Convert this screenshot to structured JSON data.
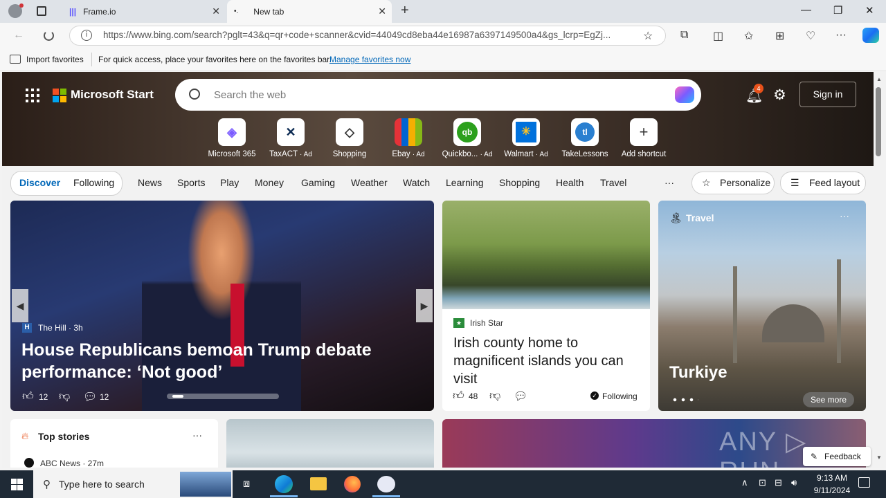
{
  "tabs": [
    {
      "title": "Frame.io"
    },
    {
      "title": "New tab"
    }
  ],
  "address_bar": {
    "url": "https://www.bing.com/search?pglt=43&q=qr+code+scanner&cvid=44049cd8eba44e16987a6397149500a4&gs_lcrp=EgZj..."
  },
  "favorites_bar": {
    "import_label": "Import favorites",
    "hint": "For quick access, place your favorites here on the favorites bar.",
    "manage_link": "Manage favorites now"
  },
  "header": {
    "brand": "Microsoft Start",
    "search_placeholder": "Search the web",
    "notification_count": "4",
    "sign_in": "Sign in"
  },
  "shortcuts": [
    {
      "label": "Microsoft 365",
      "ad": ""
    },
    {
      "label": "TaxACT",
      "ad": "· Ad"
    },
    {
      "label": "Shopping",
      "ad": ""
    },
    {
      "label": "Ebay",
      "ad": "· Ad"
    },
    {
      "label": "Quickbo...",
      "ad": "· Ad"
    },
    {
      "label": "Walmart",
      "ad": "· Ad"
    },
    {
      "label": "TakeLessons",
      "ad": ""
    },
    {
      "label": "Add shortcut",
      "ad": ""
    }
  ],
  "categories": {
    "discover": "Discover",
    "following": "Following",
    "items": [
      "News",
      "Sports",
      "Play",
      "Money",
      "Gaming",
      "Weather",
      "Watch",
      "Learning",
      "Shopping",
      "Health",
      "Travel"
    ],
    "more": "···",
    "personalize": "Personalize",
    "feed_layout": "Feed layout"
  },
  "main_story": {
    "source": "The Hill · 3h",
    "headline": "House Republicans bemoan Trump debate performance: ‘Not good’",
    "likes": "12",
    "comments": "12"
  },
  "irish_story": {
    "source": "Irish Star",
    "headline": "Irish county home to magnificent islands you can visit",
    "likes": "48",
    "following": "Following"
  },
  "travel_card": {
    "label": "Travel",
    "destination": "Turkiye",
    "see_more": "See more"
  },
  "top_stories": {
    "title": "Top stories",
    "first_source": "ABC News · 27m"
  },
  "feedback": "Feedback",
  "taskbar": {
    "search_placeholder": "Type here to search",
    "time": "9:13 AM",
    "date": "9/11/2024"
  },
  "colors": {
    "accent": "#0067b8",
    "taskbar": "#1f2a36",
    "notification": "#e8511a"
  }
}
